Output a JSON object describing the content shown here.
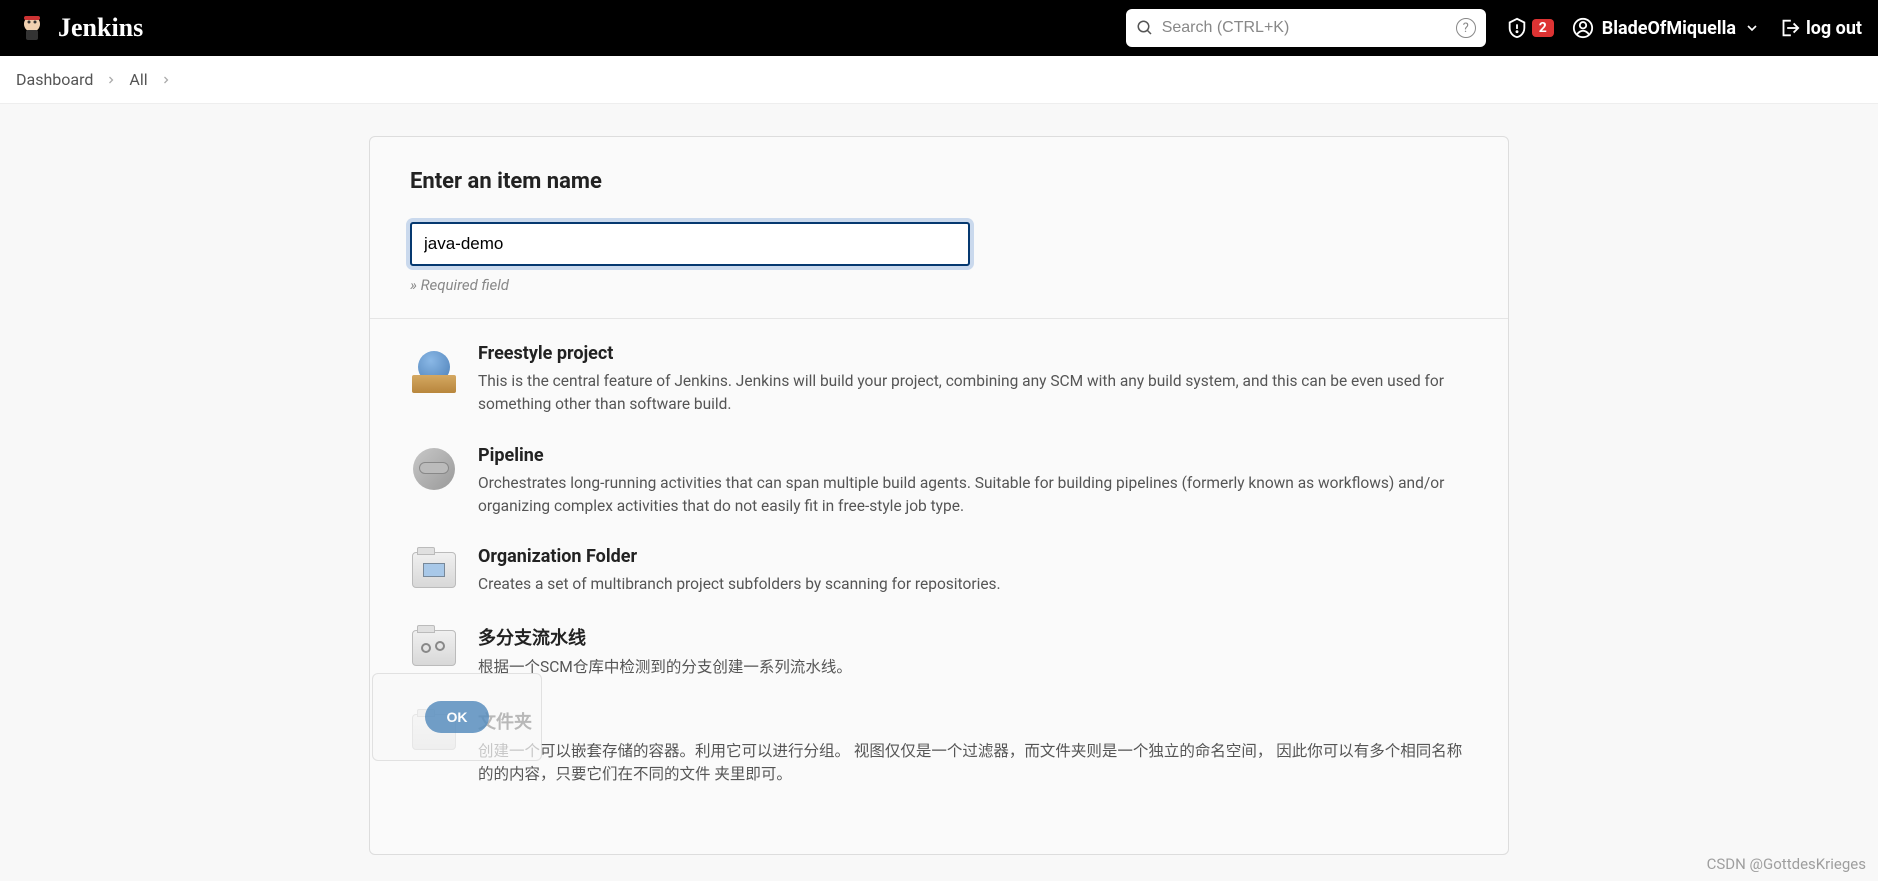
{
  "header": {
    "logo_text": "Jenkins",
    "search_placeholder": "Search (CTRL+K)",
    "notification_count": "2",
    "user_name": "BladeOfMiquella",
    "logout_label": "log out"
  },
  "breadcrumb": {
    "items": [
      "Dashboard",
      "All"
    ]
  },
  "main": {
    "title": "Enter an item name",
    "input_value": "java-demo",
    "required_note": "» Required field",
    "options": [
      {
        "title": "Freestyle project",
        "desc": "This is the central feature of Jenkins. Jenkins will build your project, combining any SCM with any build system, and this can be even used for something other than software build."
      },
      {
        "title": "Pipeline",
        "desc": "Orchestrates long-running activities that can span multiple build agents. Suitable for building pipelines (formerly known as workflows) and/or organizing complex activities that do not easily fit in free-style job type."
      },
      {
        "title": "Organization Folder",
        "desc": "Creates a set of multibranch project subfolders by scanning for repositories."
      },
      {
        "title": "多分支流水线",
        "desc": "根据一个SCM仓库中检测到的分支创建一系列流水线。"
      },
      {
        "title": "文件夹",
        "desc": "创建一个可以嵌套存储的容器。利用它可以进行分组。 视图仅仅是一个过滤器，而文件夹则是一个独立的命名空间， 因此你可以有多个相同名称的的内容，只要它们在不同的文件 夹里即可。"
      }
    ],
    "ok_label": "OK"
  },
  "watermark": "CSDN @GottdesKrieges"
}
